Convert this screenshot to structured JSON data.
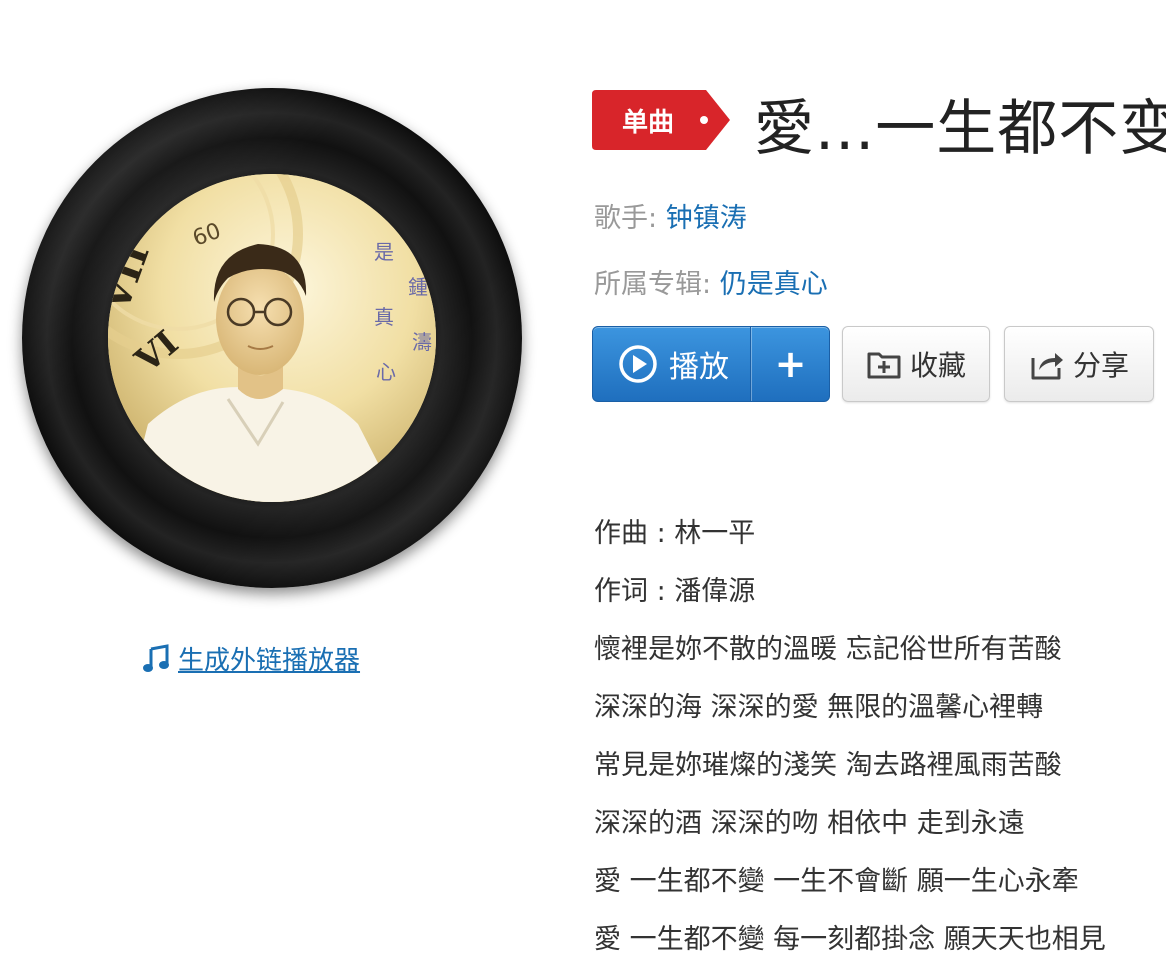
{
  "song": {
    "badge": "单曲",
    "title": "愛...一生都不变",
    "singer_label": "歌手",
    "singer": "钟镇涛",
    "album_label": "所属专辑",
    "album": "仍是真心",
    "colon": ":"
  },
  "cover": {
    "text_chars": [
      "是",
      "真",
      "心",
      "鍾",
      "濤"
    ],
    "clock_numerals": [
      "VII",
      "VI",
      "60"
    ]
  },
  "actions": {
    "play": "播放",
    "add": "+",
    "favorite": "收藏",
    "share": "分享"
  },
  "external_link": "生成外链播放器",
  "lyrics": [
    "作曲 : 林一平",
    "作词 : 潘偉源",
    "懷裡是妳不散的溫暖 忘記俗世所有苦酸",
    "深深的海 深深的愛 無限的溫馨心裡轉",
    "常見是妳璀燦的淺笑 淘去路裡風雨苦酸",
    "深深的酒 深深的吻 相依中 走到永遠",
    "愛 一生都不變 一生不會斷 願一生心永牽",
    "愛 一生都不變 每一刻都掛念 願天天也相見"
  ],
  "colors": {
    "link": "#1a6fb3",
    "badge": "#d8252a",
    "play_button": "#2a82d0",
    "meta_label": "#999999"
  }
}
